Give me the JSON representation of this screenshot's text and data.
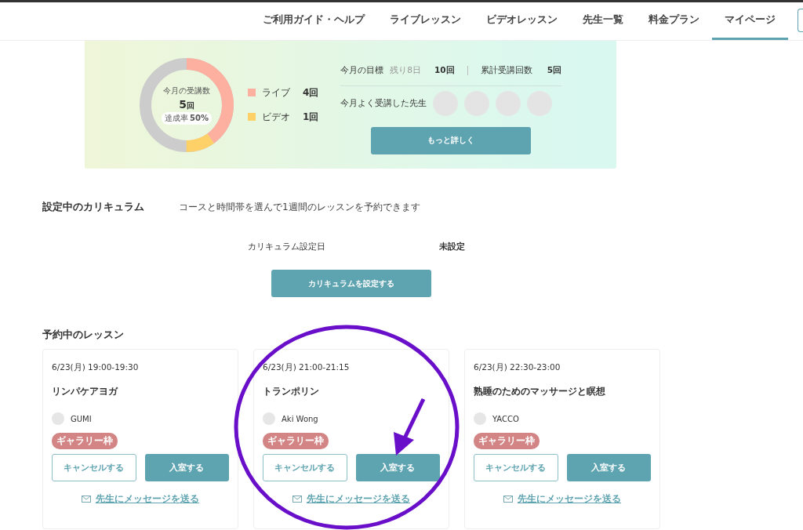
{
  "nav": {
    "items": [
      {
        "label": "ご利用ガイド・ヘルプ",
        "selected": false
      },
      {
        "label": "ライブレッスン",
        "selected": false
      },
      {
        "label": "ビデオレッスン",
        "selected": false
      },
      {
        "label": "先生一覧",
        "selected": false
      },
      {
        "label": "料金プラン",
        "selected": false
      },
      {
        "label": "マイページ",
        "selected": true
      }
    ]
  },
  "summary": {
    "donut_title": "今月の受講数",
    "donut_count": "5",
    "donut_unit": "回",
    "rate_label": "達成率",
    "rate_value": "50%",
    "legend": [
      {
        "label": "ライブ",
        "value": "4回",
        "color": "#fdb09f"
      },
      {
        "label": "ビデオ",
        "value": "1回",
        "color": "#fdd167"
      }
    ],
    "goal_label": "今月の目標",
    "goal_remaining": "残り8日",
    "goal_value": "10回",
    "total_label": "累計受講回数",
    "total_value": "5回",
    "teachers_label": "今月よく受講した先生",
    "more_button": "もっと詳しく"
  },
  "curriculum": {
    "title": "設定中のカリキュラム",
    "description": "コースと時間帯を選んで1週間のレッスンを予約できます",
    "date_label": "カリキュラム設定日",
    "date_value": "未設定",
    "button": "カリキュラムを設定する"
  },
  "lessons": {
    "title": "予約中のレッスン",
    "cards": [
      {
        "datetime": "6/23(月) 19:00-19:30",
        "name": "リンパケアヨガ",
        "teacher": "GUMI",
        "badge": "ギャラリー枠",
        "cancel": "キャンセルする",
        "enter": "入室する",
        "message": "先生にメッセージを送る"
      },
      {
        "datetime": "6/23(月) 21:00-21:15",
        "name": "トランポリン",
        "teacher": "Aki Wong",
        "badge": "ギャラリー枠",
        "cancel": "キャンセルする",
        "enter": "入室する",
        "message": "先生にメッセージを送る"
      },
      {
        "datetime": "6/23(月) 22:30-23:00",
        "name": "熟睡のためのマッサージと瞑想",
        "teacher": "YACCO",
        "badge": "ギャラリー枠",
        "cancel": "キャンセルする",
        "enter": "入室する",
        "message": "先生にメッセージを送る"
      }
    ]
  }
}
